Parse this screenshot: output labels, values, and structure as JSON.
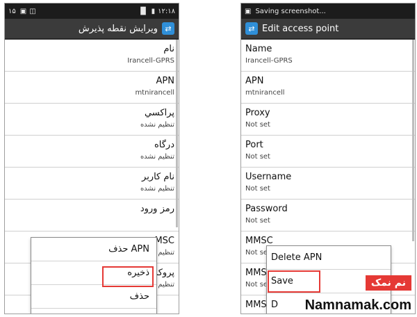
{
  "left_screen": {
    "status_bar": {
      "left_text": "۱۵",
      "time": "۱۲:۱۸"
    },
    "action_bar": {
      "title": "ویرایش نقطه پذیرش"
    },
    "fields": [
      {
        "label": "نام",
        "value": "Irancell-GPRS"
      },
      {
        "label": "APN",
        "value": "mtnirancell"
      },
      {
        "label": "پراکسي",
        "value": "تنظیم نشده"
      },
      {
        "label": "درگاه",
        "value": "تنظیم نشده"
      },
      {
        "label": "نام کاربر",
        "value": "تنظیم نشده"
      },
      {
        "label": "رمز ورود",
        "value": ""
      },
      {
        "label": "MSC",
        "value": "تنظیم"
      },
      {
        "label": "پروکس",
        "value": "تنظیم"
      }
    ],
    "menu": [
      "حذف APN",
      "ذخیره",
      "حذف"
    ],
    "highlighted_item": "ذخیره"
  },
  "right_screen": {
    "status_bar": {
      "notification": "Saving screenshot..."
    },
    "action_bar": {
      "title": "Edit access point"
    },
    "fields": [
      {
        "label": "Name",
        "value": "Irancell-GPRS"
      },
      {
        "label": "APN",
        "value": "mtnirancell"
      },
      {
        "label": "Proxy",
        "value": "Not set"
      },
      {
        "label": "Port",
        "value": "Not set"
      },
      {
        "label": "Username",
        "value": "Not set"
      },
      {
        "label": "Password",
        "value": "Not set"
      },
      {
        "label": "MMSC",
        "value": "Not se"
      },
      {
        "label": "MMS",
        "value": "Not se"
      },
      {
        "label": "MMS",
        "value": ""
      }
    ],
    "menu": [
      "Delete APN",
      "Save",
      "D"
    ],
    "highlighted_item": "Save"
  },
  "watermark": {
    "fa": "نم نمک",
    "en": "Namnamak.com"
  },
  "colors": {
    "status_bar": "#1c1c1c",
    "action_bar": "#3b3b3b",
    "icon_blue": "#2f8fd8",
    "highlight_red": "#e53935"
  }
}
